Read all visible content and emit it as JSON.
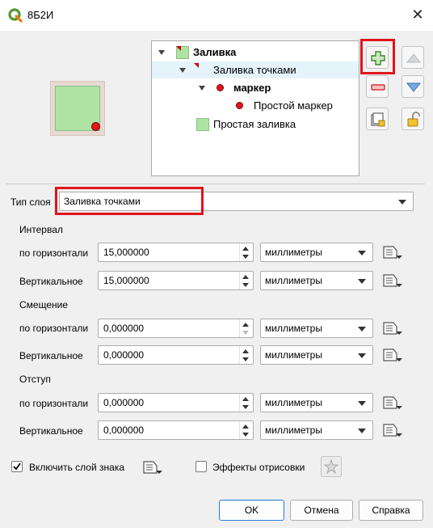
{
  "window": {
    "title": "8Б2И",
    "close_glyph": "✕"
  },
  "tree": {
    "items": [
      {
        "label": "Заливка",
        "bold": true
      },
      {
        "label": "Заливка точками",
        "bold": false
      },
      {
        "label": "маркер",
        "bold": true
      },
      {
        "label": "Простой маркер",
        "bold": false
      },
      {
        "label": "Простая заливка",
        "bold": false
      }
    ]
  },
  "side_buttons": {
    "add": "add-layer-icon",
    "up": "move-up-icon",
    "remove": "remove-layer-icon",
    "down": "move-down-icon",
    "duplicate": "duplicate-icon",
    "lock": "lock-icon"
  },
  "layer_type": {
    "label": "Тип слоя",
    "value": "Заливка точками"
  },
  "sections": {
    "interval": {
      "title": "Интервал",
      "rows": [
        {
          "label": "по горизонтали",
          "value": "15,000000",
          "unit": "миллиметры"
        },
        {
          "label": "Вертикальное",
          "value": "15,000000",
          "unit": "миллиметры"
        }
      ]
    },
    "offset": {
      "title": "Смещение",
      "rows": [
        {
          "label": "по горизонтали",
          "value": "0,000000",
          "unit": "миллиметры"
        },
        {
          "label": "Вертикальное",
          "value": "0,000000",
          "unit": "миллиметры"
        }
      ]
    },
    "displacement": {
      "title": "Отступ",
      "rows": [
        {
          "label": "по горизонтали",
          "value": "0,000000",
          "unit": "миллиметры"
        },
        {
          "label": "Вертикальное",
          "value": "0,000000",
          "unit": "миллиметры"
        }
      ]
    }
  },
  "footer": {
    "enable_layer": {
      "label": "Включить слой знака",
      "checked": true
    },
    "effects": {
      "label": "Эффекты отрисовки",
      "checked": false
    },
    "ok": "OK",
    "cancel": "Отмена",
    "help": "Справка"
  },
  "colors": {
    "fill": "#aee3a3",
    "marker": "#e1141c",
    "highlight": "#e0141b"
  }
}
